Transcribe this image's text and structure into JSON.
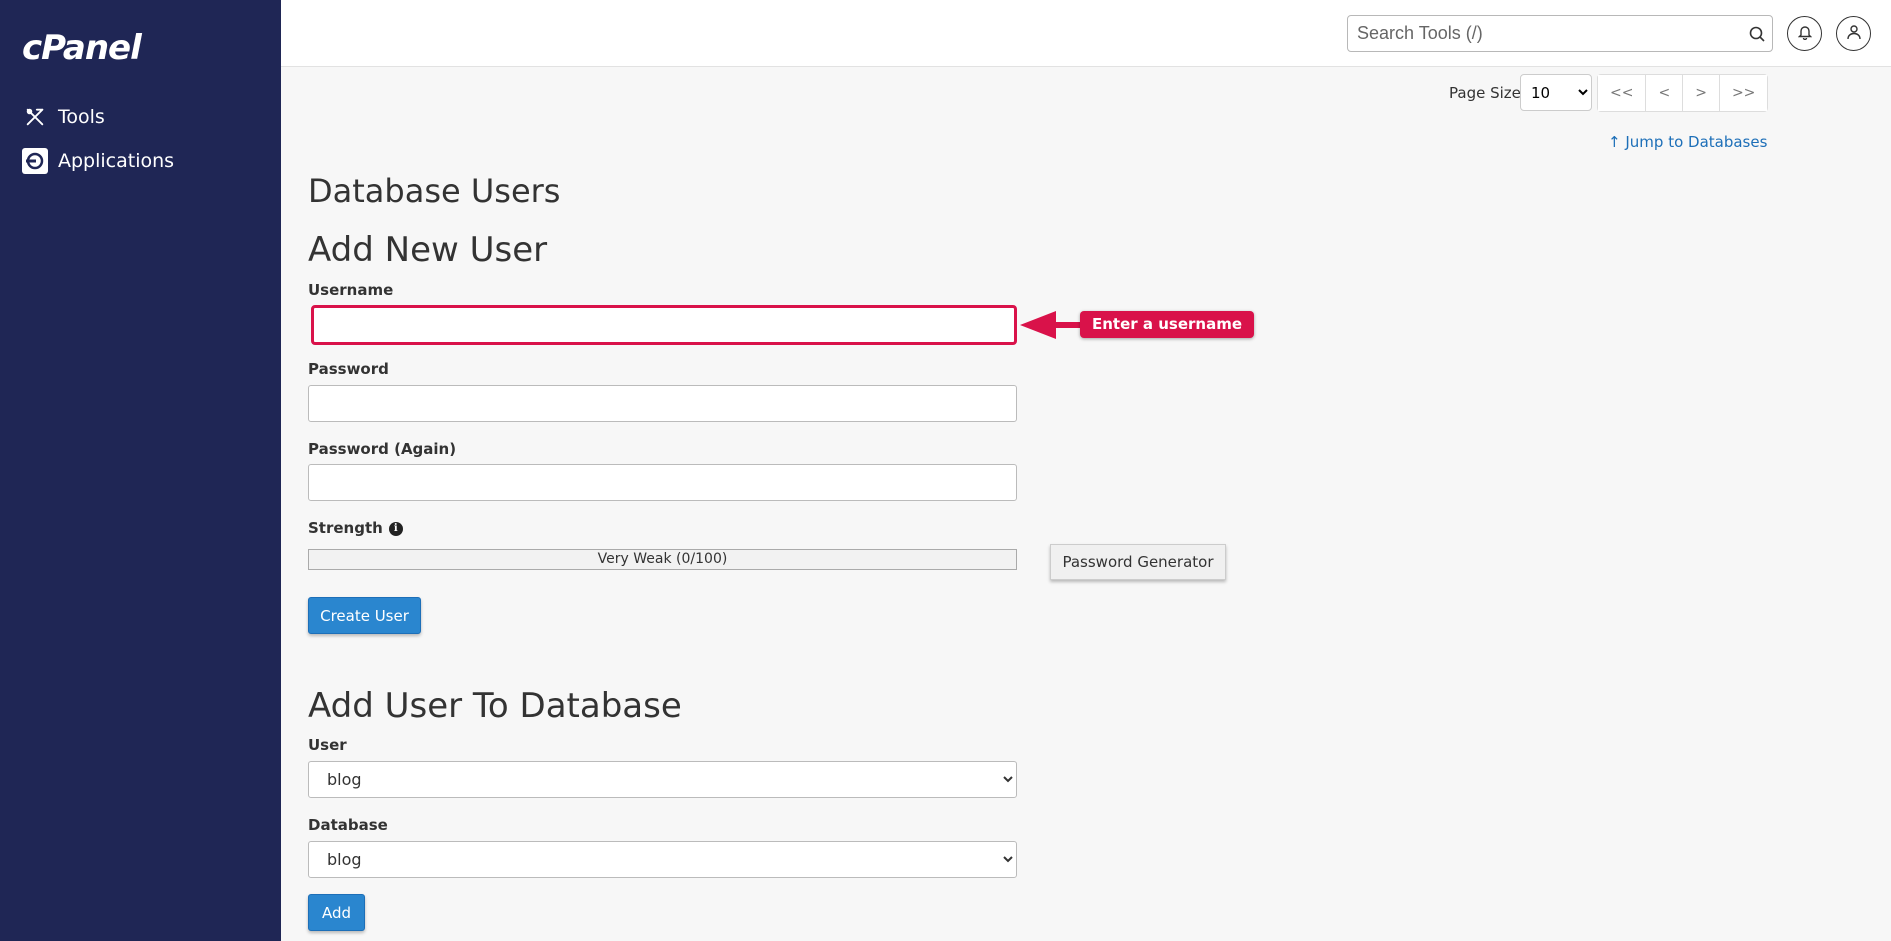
{
  "sidebar": {
    "logo": "cPanel",
    "items": [
      {
        "label": "Tools",
        "icon": "tools-icon"
      },
      {
        "label": "Applications",
        "icon": "applications-icon"
      }
    ]
  },
  "header": {
    "search_placeholder": "Search Tools (/)"
  },
  "pagination": {
    "page_size_label": "Page Size",
    "page_size_value": "10",
    "buttons": [
      "<<",
      "<",
      ">",
      ">>"
    ]
  },
  "jump_link": "Jump to Databases",
  "db_users": {
    "title": "Database Users",
    "add_new_user": {
      "title": "Add New User",
      "username_label": "Username",
      "password_label": "Password",
      "password_again_label": "Password (Again)",
      "strength_label": "Strength",
      "strength_value": "Very Weak (0/100)",
      "password_generator": "Password Generator",
      "create_button": "Create User"
    }
  },
  "add_user_to_db": {
    "title": "Add User To Database",
    "user_label": "User",
    "user_value": "blog",
    "database_label": "Database",
    "database_value": "blog",
    "add_button": "Add"
  },
  "annotation": {
    "text": "Enter a username",
    "color": "#d9124a"
  },
  "colors": {
    "sidebar_bg": "#1f2655",
    "primary": "#2a86cf",
    "link": "#1d6fb8"
  }
}
